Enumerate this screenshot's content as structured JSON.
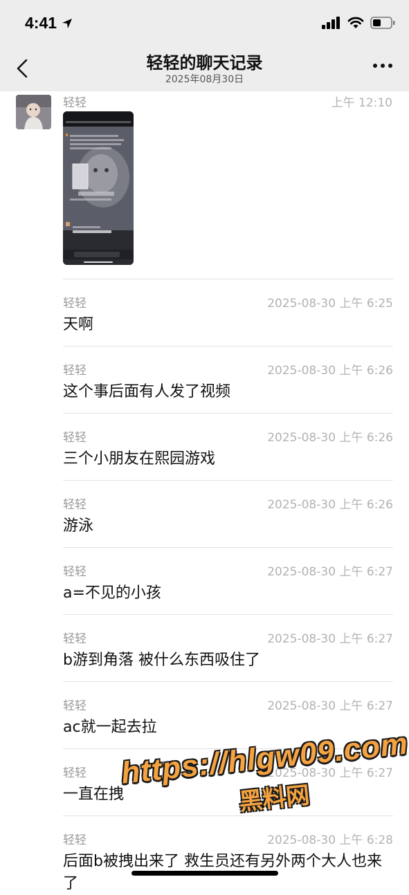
{
  "status": {
    "time": "4:41"
  },
  "header": {
    "title": "轻轻的聊天记录",
    "subtitle": "2025年08月30日"
  },
  "first_message": {
    "sender": "轻轻",
    "time": "上午 12:10",
    "content_type": "image"
  },
  "messages": [
    {
      "sender": "轻轻",
      "time": "2025-08-30 上午 6:25",
      "text": "天啊"
    },
    {
      "sender": "轻轻",
      "time": "2025-08-30 上午 6:26",
      "text": "这个事后面有人发了视频"
    },
    {
      "sender": "轻轻",
      "time": "2025-08-30 上午 6:26",
      "text": "三个小朋友在熙园游戏"
    },
    {
      "sender": "轻轻",
      "time": "2025-08-30 上午 6:26",
      "text": "游泳"
    },
    {
      "sender": "轻轻",
      "time": "2025-08-30 上午 6:27",
      "text": "a=不见的小孩"
    },
    {
      "sender": "轻轻",
      "time": "2025-08-30 上午 6:27",
      "text": "b游到角落 被什么东西吸住了"
    },
    {
      "sender": "轻轻",
      "time": "2025-08-30 上午 6:27",
      "text": "ac就一起去拉"
    },
    {
      "sender": "轻轻",
      "time": "2025-08-30 上午 6:27",
      "text": "一直在拽"
    },
    {
      "sender": "轻轻",
      "time": "2025-08-30 上午 6:28",
      "text": "后面b被拽出来了 救生员还有另外两个大人也来了"
    }
  ],
  "watermark": {
    "url": "https://hlgw09.com",
    "label": "黑料网"
  },
  "colors": {
    "header_bg": "#ededed",
    "name_gray": "#9a9a9a",
    "time_gray": "#b2b2b2",
    "watermark": "#f5a340"
  }
}
